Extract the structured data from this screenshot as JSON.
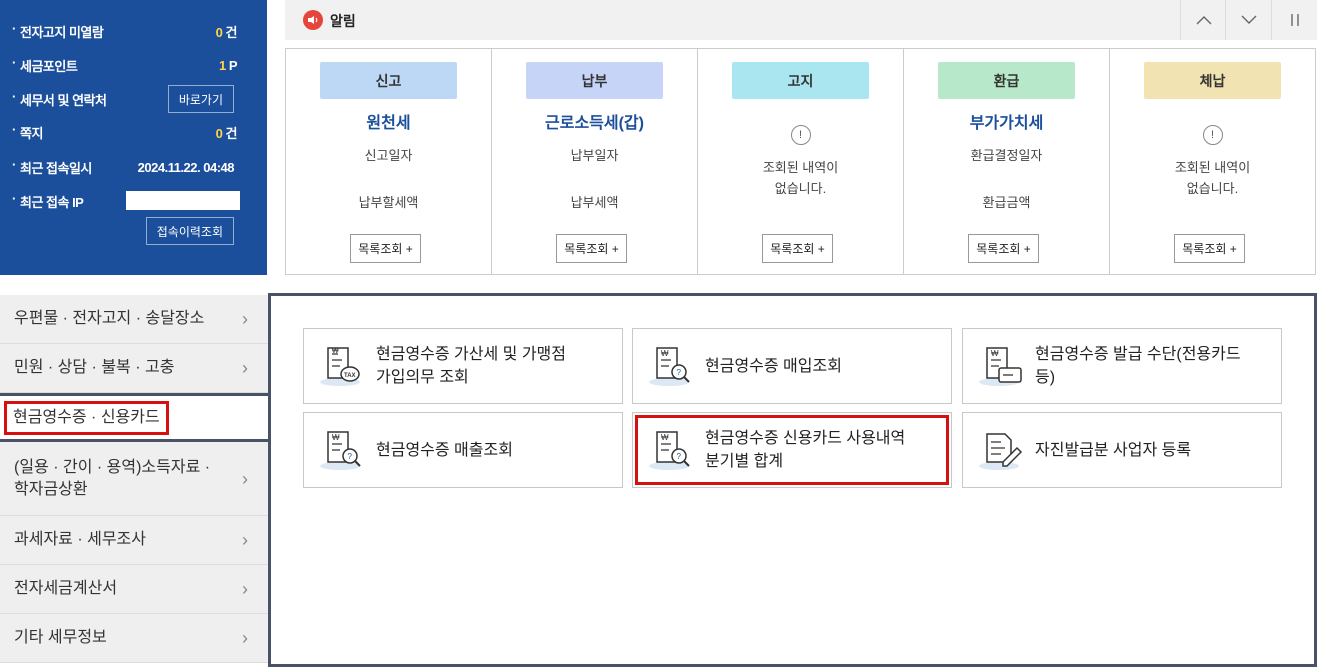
{
  "user_panel": {
    "unread_notice_label": "전자고지 미열람",
    "unread_notice_value": "0",
    "unread_notice_unit": "건",
    "tax_points_label": "세금포인트",
    "tax_points_value": "1",
    "tax_points_unit": "P",
    "tax_office_label": "세무서 및 연락처",
    "tax_office_button": "바로가기",
    "messages_label": "쪽지",
    "messages_value": "0",
    "messages_unit": "건",
    "last_login_label": "최근 접속일시",
    "last_login_value": "2024.11.22.  04:48",
    "last_ip_label": "최근 접속 IP",
    "login_history_button": "접속이력조회"
  },
  "notice": {
    "title": "알림",
    "icon": "speaker-icon",
    "up": "up-arrow",
    "down": "down-arrow",
    "pause": "pause"
  },
  "status_cards": [
    {
      "chip": "신고",
      "chip_color": "#bcd8f5",
      "title": "원천세",
      "line1": "신고일자",
      "line2": "납부할세액",
      "button": "목록조회 +"
    },
    {
      "chip": "납부",
      "chip_color": "#c6d4f8",
      "title": "근로소득세(갑)",
      "line1": "납부일자",
      "line2": "납부세액",
      "button": "목록조회 +"
    },
    {
      "chip": "고지",
      "chip_color": "#a9e6f0",
      "empty_text_1": "조회된 내역이",
      "empty_text_2": "없습니다.",
      "button": "목록조회 +"
    },
    {
      "chip": "환급",
      "chip_color": "#b7e8c9",
      "title": "부가가치세",
      "line1": "환급결정일자",
      "line2": "환급금액",
      "button": "목록조회 +"
    },
    {
      "chip": "체납",
      "chip_color": "#f2e3b3",
      "empty_text_1": "조회된 내역이",
      "empty_text_2": "없습니다.",
      "button": "목록조회 +"
    }
  ],
  "menu": [
    {
      "label": "우편물 · 전자고지 · 송달장소"
    },
    {
      "label": "민원 · 상담 · 불복 · 고충"
    },
    {
      "label": "현금영수증 · 신용카드"
    },
    {
      "label_1": "(일용 · 간이 · 용역)소득자료 ·",
      "label_2": "학자금상환"
    },
    {
      "label": "과세자료 · 세무조사"
    },
    {
      "label": "전자세금계산서"
    },
    {
      "label": "기타 세무정보"
    }
  ],
  "services": [
    {
      "line1": "현금영수증 가산세 및 가맹점",
      "line2": "가입의무 조회",
      "icon": "receipt-tax-icon"
    },
    {
      "line1": "현금영수증 매입조회",
      "line2": "",
      "icon": "receipt-search-icon"
    },
    {
      "line1": "현금영수증 발급 수단(전용카드",
      "line2": "등)",
      "icon": "receipt-card-icon"
    },
    {
      "line1": "현금영수증 매출조회",
      "line2": "",
      "icon": "receipt-search-icon"
    },
    {
      "line1": "현금영수증 신용카드 사용내역",
      "line2": "분기별 합계",
      "icon": "receipt-search-icon"
    },
    {
      "line1": "자진발급분 사업자 등록",
      "line2": "",
      "icon": "document-pen-icon"
    }
  ],
  "colors": {
    "panel_blue": "#1b4f9c",
    "highlight_red": "#d60f0f",
    "point_yellow": "#ffd54a"
  }
}
